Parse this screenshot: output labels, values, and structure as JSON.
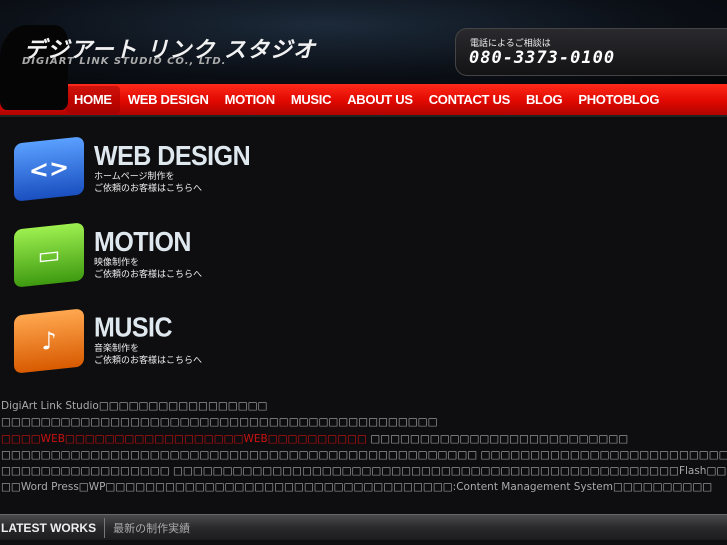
{
  "header": {
    "logo_jp": "デジアート リンク スタジオ",
    "logo_en": "DIGIART LINK STUDIO CO., LTD.",
    "phone_label": "電話によるご相談は",
    "phone_number": "080-3373-0100"
  },
  "nav": [
    "HOME",
    "WEB DESIGN",
    "MOTION",
    "MUSIC",
    "ABOUT US",
    "CONTACT US",
    "BLOG",
    "PHOTOBLOG"
  ],
  "services": [
    {
      "title": "WEB DESIGN",
      "line1": "ホームページ制作を",
      "line2": "ご依頼のお客様はこちらへ",
      "icon": "<>",
      "color": "#2a6fe0"
    },
    {
      "title": "MOTION",
      "line1": "映像制作を",
      "line2": "ご依頼のお客様はこちらへ",
      "icon": "▭",
      "color": "#6cc82a"
    },
    {
      "title": "MUSIC",
      "line1": "音楽制作を",
      "line2": "ご依頼のお客様はこちらへ",
      "icon": "♪",
      "color": "#f07a18"
    }
  ],
  "body": {
    "l1": "DigiArt Link Studio□□□□□□□□□□□□□□□□□",
    "l2": "□□□□□□□□□□□□□□□□□□□□□□□□□□□□□□□□□□□□□□□□□□□□",
    "l3_red": "□□□□WEB□□□□□□□□□□□□□□□□□□WEB□□□□□□□□□□",
    "l3_grey": " □□□□□□□□□□□□□□□□□□□□□□□□□□",
    "l4": "□□□□□□□□□□□□□□□□□□□□□□□□□□□□□□□□□□□□□□□□□□□□□□□□ □□□□□□□□□□□□□□□□□□□□□□□□□□□□□□□□□□□□□□□□□□□□□□□□Flash□□□□□□□□□□□□CM□□□□□□□□□□□□□",
    "l5": "□□□□□□□□□□□□□□□□□ □□□□□□□□□□□□□□□□□□□□□□□□□□□□□□□□□□□□□□□□□□□□□□□□□□□Flash□□□XHTML+CSS□□□□CSS□□□□□□□□□□□□□□□□□□□□□□□□ □□□□□□□",
    "l6": "□□Word Press□WP□□□□□□□□□□□□□□□□□□□□□□□□□□□□□□□□□□□:Content Management System□□□□□□□□□□"
  },
  "latest": {
    "en": "LATEST WORKS",
    "jp": "最新の制作実績"
  }
}
